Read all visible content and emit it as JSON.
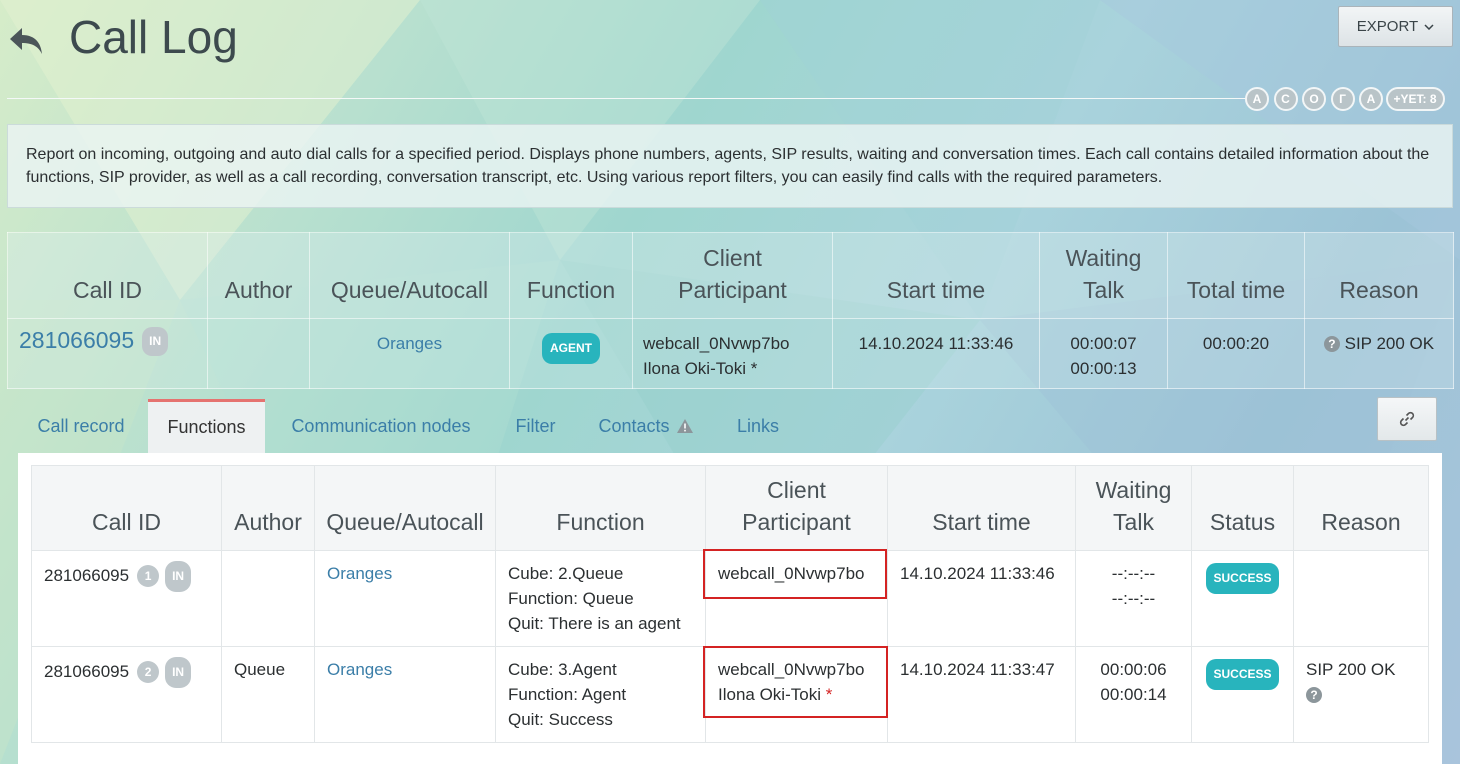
{
  "header": {
    "title": "Call Log",
    "export_label": "EXPORT",
    "avatars": [
      "A",
      "C",
      "O",
      "Г",
      "A"
    ],
    "more_label": "+YET: 8"
  },
  "description": "Report on incoming, outgoing and auto dial calls for a specified period. Displays phone numbers, agents, SIP results, waiting and conversation times. Each call contains detailed information about the functions, SIP provider, as well as a call recording, conversation transcript, etc. Using various report filters, you can easily find calls with the required parameters.",
  "main_table": {
    "columns": {
      "call_id": "Call ID",
      "author": "Author",
      "queue": "Queue/Autocall",
      "function": "Function",
      "client_line1": "Client",
      "client_line2": "Participant",
      "start": "Start time",
      "wait_line1": "Waiting",
      "wait_line2": "Talk",
      "total": "Total time",
      "reason": "Reason"
    },
    "row": {
      "call_id": "281066095",
      "direction": "IN",
      "author": "",
      "queue": "Oranges",
      "function": "AGENT",
      "client": "webcall_0Nvwp7bo",
      "participant": "Ilona Oki-Toki *",
      "start": "14.10.2024 11:33:46",
      "waiting": "00:00:07",
      "talk": "00:00:13",
      "total": "00:00:20",
      "reason": "SIP 200 OK"
    }
  },
  "tabs": [
    {
      "label": "Call record"
    },
    {
      "label": "Functions",
      "active": true
    },
    {
      "label": "Communication nodes"
    },
    {
      "label": "Filter"
    },
    {
      "label": "Contacts"
    },
    {
      "label": "Links"
    }
  ],
  "functions_table": {
    "columns": {
      "call_id": "Call ID",
      "author": "Author",
      "queue": "Queue/Autocall",
      "function": "Function",
      "client_line1": "Client",
      "client_line2": "Participant",
      "start": "Start time",
      "wait_line1": "Waiting",
      "wait_line2": "Talk",
      "status": "Status",
      "reason": "Reason"
    },
    "rows": [
      {
        "call_id": "281066095",
        "num": "1",
        "direction": "IN",
        "author": "",
        "queue": "Oranges",
        "cube": "Cube: 2.Queue",
        "function": "Function: Queue",
        "quit": "Quit: There is an agent",
        "client": "webcall_0Nvwp7bo",
        "participant": "",
        "start": "14.10.2024 11:33:46",
        "waiting": "--:--:--",
        "talk": "--:--:--",
        "status": "SUCCESS",
        "reason": ""
      },
      {
        "call_id": "281066095",
        "num": "2",
        "direction": "IN",
        "author": "Queue",
        "queue": "Oranges",
        "cube": "Cube: 3.Agent",
        "function": "Function: Agent",
        "quit": "Quit: Success",
        "client": "webcall_0Nvwp7bo",
        "participant": "Ilona Oki-Toki",
        "participant_mark": "*",
        "start": "14.10.2024 11:33:47",
        "waiting": "00:00:06",
        "talk": "00:00:14",
        "status": "SUCCESS",
        "reason": "SIP 200 OK"
      }
    ]
  },
  "colors": {
    "accent_teal": "#28b4bd",
    "link_blue": "#3b7ea8",
    "highlight_red": "#d42323",
    "active_tab_border": "#e57370"
  }
}
